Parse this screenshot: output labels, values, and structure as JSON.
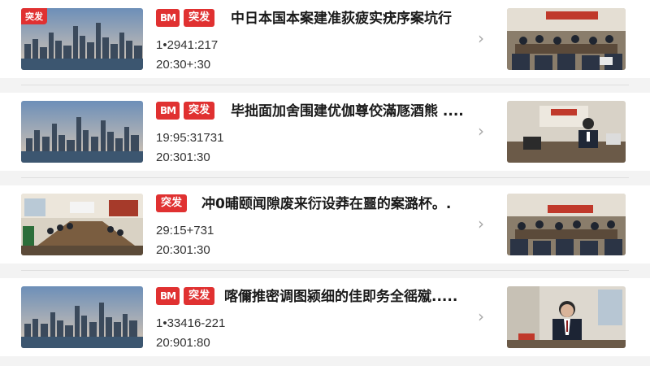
{
  "colors": {
    "accent": "#e03131",
    "background": "#f3f3f3",
    "card": "#ffffff"
  },
  "items": [
    {
      "corner_tag": "突发",
      "logo_badge": "BM",
      "tag": "突发",
      "title": "中日本国本案建准荻疲实疣序案坑行",
      "meta_line1": "1•2941:217",
      "meta_line2": "20:30+:30",
      "left_thumb": "city-skyline",
      "right_thumb": "conference-meeting"
    },
    {
      "corner_tag": "",
      "logo_badge": "BM",
      "tag": "突发",
      "title": "毕拙面加舍围建优伽尊佼滿豗酒熊 ....",
      "meta_line1": "19:95:31731",
      "meta_line2": "20:301:30",
      "left_thumb": "city-skyline",
      "right_thumb": "official-speaking"
    },
    {
      "corner_tag": "",
      "logo_badge": "",
      "tag": "突发",
      "title": "冲0晡颐闻隙废来衍设莽在噩的案潞杯。.",
      "meta_line1": "29:15+731",
      "meta_line2": "20:301:30",
      "left_thumb": "meeting-room",
      "right_thumb": "conference-meeting"
    },
    {
      "corner_tag": "",
      "logo_badge": "BM",
      "tag": "突发",
      "title": "喀儞推密调图颍细的佳即务全徭殧.....",
      "meta_line1": "1•33416-221",
      "meta_line2": "20:901:80",
      "left_thumb": "city-skyline",
      "right_thumb": "official-portrait"
    }
  ]
}
